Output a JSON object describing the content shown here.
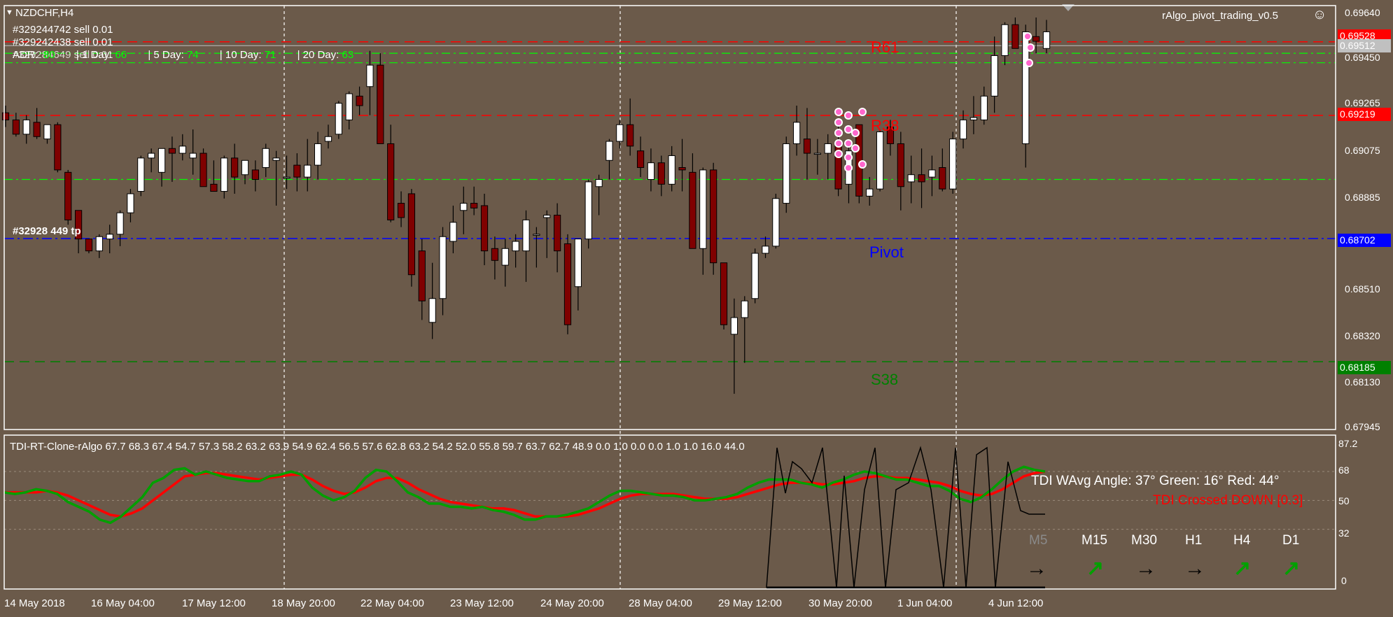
{
  "colors": {
    "background": "#6b5a4a",
    "grid": "#ffffff",
    "bull_candle": "#ffffff",
    "bear_candle": "#800000",
    "resistance": "#ff0000",
    "pivot": "#0000ff",
    "support": "#008000",
    "tdi_green": "#00a000",
    "tdi_red": "#ff0000",
    "arrow_up": "#00a000",
    "arrow_flat": "#000000"
  },
  "header": {
    "symbol_label": "NZDCHF,H4",
    "indicator_name": "rAlgo_pivot_trading_v0.5",
    "smiley_icon": "☺"
  },
  "orders": [
    {
      "text": "#329244742 sell 0.01"
    },
    {
      "text": "#329242438 sell 0.01"
    },
    {
      "text": "#329284649 sell 0.01"
    }
  ],
  "order_tp_label": "#32928 449 tp",
  "ranges": {
    "prefix": "ADR:",
    "items": [
      {
        "label": "ADR:",
        "value": "80"
      },
      {
        "label": "| 1 Day:",
        "value": "66"
      },
      {
        "label": "| 5 Day:",
        "value": "74"
      },
      {
        "label": "| 10 Day:",
        "value": "71"
      },
      {
        "label": "| 20 Day:",
        "value": "63"
      }
    ]
  },
  "levels": {
    "r61": {
      "label": "R61",
      "price": "0.69528"
    },
    "r38": {
      "label": "R38",
      "price": "0.69219"
    },
    "pivot": {
      "label": "Pivot",
      "price": "0.68702"
    },
    "s38": {
      "label": "S38",
      "price": "0.68185"
    },
    "current": {
      "price": "0.69512"
    }
  },
  "price_axis": [
    "0.69640",
    "0.69450",
    "0.69265",
    "0.69075",
    "0.68885",
    "0.68510",
    "0.68320",
    "0.68130",
    "0.67945"
  ],
  "time_axis": [
    "14 May 2018",
    "16 May 04:00",
    "17 May 12:00",
    "18 May 20:00",
    "22 May 04:00",
    "23 May 12:00",
    "24 May 20:00",
    "28 May 04:00",
    "29 May 12:00",
    "30 May 20:00",
    "1 Jun 04:00",
    "4 Jun 12:00"
  ],
  "tdi": {
    "title": "TDI-RT-Clone-rAlgo 67.7 68.3 67.4 54.7 57.3 58.2 63.2 63.9 54.9 62.4 56.5 57.6 62.8 63.2 54.2 52.0 55.8 59.7 63.7 62.7 48.9 0.0 1.0 0.0 0.0 1.0 1.0 16.0 44.0",
    "axis": [
      "87.2",
      "68",
      "50",
      "32",
      "0"
    ],
    "angle_text": "TDI WAvg Angle: 37°  Green: 16°  Red: 44°",
    "cross_text": "TDI Crossed DOWN [0.3]",
    "timeframes": [
      {
        "label": "M5",
        "arrow": "→",
        "dir": "flat"
      },
      {
        "label": "M15",
        "arrow": "↗",
        "dir": "up"
      },
      {
        "label": "M30",
        "arrow": "→",
        "dir": "flat"
      },
      {
        "label": "H1",
        "arrow": "→",
        "dir": "flat"
      },
      {
        "label": "H4",
        "arrow": "↗",
        "dir": "up"
      },
      {
        "label": "D1",
        "arrow": "↗",
        "dir": "up"
      }
    ]
  },
  "chart_data": {
    "type": "candlestick",
    "symbol": "NZDCHF",
    "timeframe": "H4",
    "ylim": [
      0.679,
      0.6968
    ],
    "candles": [
      [
        0.6923,
        0.6926,
        0.6917,
        0.692
      ],
      [
        0.692,
        0.6923,
        0.6913,
        0.6914
      ],
      [
        0.6914,
        0.6922,
        0.691,
        0.692
      ],
      [
        0.6919,
        0.6925,
        0.6912,
        0.6913
      ],
      [
        0.6912,
        0.6918,
        0.691,
        0.6918
      ],
      [
        0.6918,
        0.6919,
        0.6898,
        0.6899
      ],
      [
        0.6898,
        0.6899,
        0.6876,
        0.6878
      ],
      [
        0.6882,
        0.6882,
        0.6864,
        0.687
      ],
      [
        0.687,
        0.687,
        0.6864,
        0.6865
      ],
      [
        0.6865,
        0.6872,
        0.6862,
        0.6871
      ],
      [
        0.687,
        0.6876,
        0.6864,
        0.6872
      ],
      [
        0.6872,
        0.6882,
        0.6867,
        0.6881
      ],
      [
        0.6881,
        0.6891,
        0.6877,
        0.6889
      ],
      [
        0.689,
        0.6905,
        0.6888,
        0.6904
      ],
      [
        0.6904,
        0.6908,
        0.6898,
        0.6906
      ],
      [
        0.6898,
        0.6908,
        0.6892,
        0.6908
      ],
      [
        0.6908,
        0.6913,
        0.6894,
        0.6906
      ],
      [
        0.6906,
        0.6914,
        0.6903,
        0.6909
      ],
      [
        0.6904,
        0.6916,
        0.6897,
        0.6906
      ],
      [
        0.6906,
        0.6908,
        0.6896,
        0.6892
      ],
      [
        0.6893,
        0.6903,
        0.689,
        0.689
      ],
      [
        0.689,
        0.6905,
        0.6887,
        0.6904
      ],
      [
        0.6904,
        0.691,
        0.6889,
        0.6896
      ],
      [
        0.6897,
        0.6903,
        0.6893,
        0.6903
      ],
      [
        0.6899,
        0.6903,
        0.689,
        0.6895
      ],
      [
        0.69,
        0.691,
        0.6896,
        0.6908
      ],
      [
        0.6903,
        0.6907,
        0.6884,
        0.6904
      ],
      [
        0.6896,
        0.6905,
        0.6891,
        0.6896
      ],
      [
        0.6901,
        0.6906,
        0.689,
        0.6896
      ],
      [
        0.6896,
        0.6912,
        0.689,
        0.6901
      ],
      [
        0.6901,
        0.6915,
        0.6895,
        0.691
      ],
      [
        0.6911,
        0.6918,
        0.6908,
        0.6913
      ],
      [
        0.6914,
        0.6928,
        0.6912,
        0.6927
      ],
      [
        0.692,
        0.6932,
        0.6916,
        0.6931
      ],
      [
        0.693,
        0.6934,
        0.6922,
        0.6926
      ],
      [
        0.6934,
        0.6949,
        0.6922,
        0.6943
      ],
      [
        0.6943,
        0.6948,
        0.691,
        0.691
      ],
      [
        0.691,
        0.6918,
        0.6877,
        0.6878
      ],
      [
        0.6885,
        0.689,
        0.6875,
        0.6879
      ],
      [
        0.6889,
        0.6891,
        0.685,
        0.6855
      ],
      [
        0.6865,
        0.687,
        0.6836,
        0.6844
      ],
      [
        0.6835,
        0.686,
        0.6828,
        0.6845
      ],
      [
        0.6845,
        0.6875,
        0.6838,
        0.6871
      ],
      [
        0.6869,
        0.6884,
        0.6864,
        0.6877
      ],
      [
        0.6882,
        0.6892,
        0.6872,
        0.6885
      ],
      [
        0.6885,
        0.6892,
        0.688,
        0.6883
      ],
      [
        0.6884,
        0.6889,
        0.6859,
        0.6865
      ],
      [
        0.6866,
        0.6871,
        0.6853,
        0.6861
      ],
      [
        0.6859,
        0.687,
        0.685,
        0.6866
      ],
      [
        0.6865,
        0.6872,
        0.6858,
        0.6869
      ],
      [
        0.6865,
        0.6882,
        0.6852,
        0.6878
      ],
      [
        0.6872,
        0.6875,
        0.6858,
        0.6872
      ],
      [
        0.6879,
        0.6882,
        0.6862,
        0.688
      ],
      [
        0.688,
        0.6885,
        0.6856,
        0.6865
      ],
      [
        0.6868,
        0.6872,
        0.683,
        0.6834
      ],
      [
        0.685,
        0.687,
        0.684,
        0.687
      ],
      [
        0.687,
        0.6895,
        0.6866,
        0.6894
      ],
      [
        0.6892,
        0.6897,
        0.688,
        0.6895
      ],
      [
        0.6903,
        0.6912,
        0.6895,
        0.6911
      ],
      [
        0.6911,
        0.692,
        0.6908,
        0.6918
      ],
      [
        0.6918,
        0.6929,
        0.6905,
        0.6909
      ],
      [
        0.6907,
        0.6913,
        0.6896,
        0.69
      ],
      [
        0.6895,
        0.6908,
        0.689,
        0.6902
      ],
      [
        0.6902,
        0.6905,
        0.6888,
        0.6893
      ],
      [
        0.6893,
        0.6909,
        0.689,
        0.6905
      ],
      [
        0.69,
        0.6912,
        0.689,
        0.6899
      ],
      [
        0.6898,
        0.6906,
        0.6866,
        0.6866
      ],
      [
        0.6866,
        0.69,
        0.6855,
        0.6899
      ],
      [
        0.6899,
        0.6902,
        0.6855,
        0.686
      ],
      [
        0.686,
        0.686,
        0.6832,
        0.6834
      ],
      [
        0.683,
        0.6845,
        0.6805,
        0.6837
      ],
      [
        0.6837,
        0.6846,
        0.6818,
        0.6844
      ],
      [
        0.6845,
        0.6866,
        0.6843,
        0.6864
      ],
      [
        0.6864,
        0.6871,
        0.6862,
        0.6867
      ],
      [
        0.6867,
        0.6889,
        0.6866,
        0.6887
      ],
      [
        0.6885,
        0.6913,
        0.6881,
        0.691
      ],
      [
        0.691,
        0.6926,
        0.6905,
        0.6919
      ],
      [
        0.6912,
        0.6925,
        0.6895,
        0.6906
      ],
      [
        0.6906,
        0.6912,
        0.6897,
        0.6906
      ],
      [
        0.6906,
        0.6914,
        0.6895,
        0.691
      ],
      [
        0.691,
        0.6918,
        0.6888,
        0.6891
      ],
      [
        0.6893,
        0.691,
        0.6885,
        0.6907
      ],
      [
        0.6918,
        0.6918,
        0.6885,
        0.6888
      ],
      [
        0.6888,
        0.6896,
        0.6884,
        0.6891
      ],
      [
        0.6891,
        0.6916,
        0.689,
        0.6915
      ],
      [
        0.6917,
        0.692,
        0.6905,
        0.691
      ],
      [
        0.691,
        0.6915,
        0.6882,
        0.6892
      ],
      [
        0.6894,
        0.6905,
        0.6885,
        0.6897
      ],
      [
        0.6897,
        0.6908,
        0.6883,
        0.6894
      ],
      [
        0.6896,
        0.6905,
        0.6888,
        0.6899
      ],
      [
        0.69,
        0.6908,
        0.689,
        0.6891
      ],
      [
        0.6891,
        0.6915,
        0.6889,
        0.6912
      ],
      [
        0.6912,
        0.6924,
        0.6908,
        0.692
      ],
      [
        0.692,
        0.693,
        0.6914,
        0.6921
      ],
      [
        0.692,
        0.6934,
        0.6918,
        0.693
      ],
      [
        0.693,
        0.6955,
        0.6923,
        0.6947
      ],
      [
        0.6947,
        0.6961,
        0.6943,
        0.696
      ],
      [
        0.696,
        0.6963,
        0.695,
        0.695
      ],
      [
        0.691,
        0.696,
        0.69,
        0.6957
      ],
      [
        0.6955,
        0.6963,
        0.6948,
        0.6953
      ],
      [
        0.695,
        0.6962,
        0.6948,
        0.6957
      ]
    ],
    "tdi_green": [
      55,
      54,
      55,
      57,
      56,
      54,
      49,
      46,
      43,
      38,
      36,
      40,
      46,
      52,
      61,
      64,
      69,
      70,
      66,
      68,
      66,
      64,
      63,
      62,
      62,
      65,
      66,
      68,
      66,
      58,
      53,
      50,
      52,
      56,
      64,
      69,
      68,
      62,
      55,
      52,
      48,
      48,
      46,
      46,
      45,
      46,
      44,
      43,
      41,
      38,
      38,
      40,
      40,
      41,
      43,
      45,
      49,
      53,
      56,
      56,
      55,
      54,
      53,
      53,
      52,
      50,
      50,
      51,
      52,
      54,
      58,
      61,
      63,
      63,
      63,
      61,
      60,
      58,
      61,
      63,
      66,
      68,
      67,
      65,
      63,
      63,
      61,
      59,
      59,
      56,
      51,
      49,
      52,
      57,
      63,
      68,
      71,
      69,
      68
    ],
    "tdi_red": [
      55,
      55,
      55,
      55,
      56,
      55,
      53,
      50,
      47,
      44,
      41,
      40,
      42,
      45,
      50,
      55,
      60,
      65,
      66,
      67,
      67,
      66,
      65,
      64,
      63,
      64,
      65,
      66,
      66,
      63,
      59,
      56,
      54,
      55,
      58,
      62,
      64,
      64,
      61,
      57,
      54,
      51,
      49,
      48,
      47,
      46,
      45,
      45,
      44,
      42,
      40,
      40,
      40,
      40,
      41,
      43,
      45,
      48,
      51,
      53,
      54,
      54,
      54,
      54,
      53,
      52,
      51,
      51,
      51,
      52,
      54,
      56,
      58,
      60,
      61,
      61,
      61,
      60,
      60,
      61,
      62,
      64,
      65,
      65,
      64,
      64,
      63,
      62,
      61,
      59,
      56,
      54,
      53,
      54,
      57,
      61,
      65,
      67,
      68
    ]
  }
}
